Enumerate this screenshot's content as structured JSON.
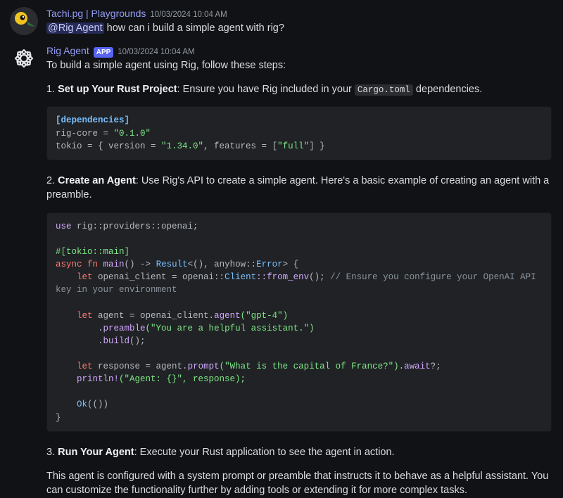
{
  "messages": [
    {
      "author": "Tachi.pg | Playgrounds",
      "timestamp": "10/03/2024 10:04 AM",
      "mention": "@Rig Agent",
      "text_after_mention": " how can i build a simple agent with rig?"
    },
    {
      "author": "Rig Agent",
      "badge": "APP",
      "timestamp": "10/03/2024 10:04 AM",
      "intro": "To build a simple agent using Rig, follow these steps:",
      "step1_num": "1. ",
      "step1_title": "Set up Your Rust Project",
      "step1_rest_a": ": Ensure you have Rig included in your ",
      "step1_code": "Cargo.toml",
      "step1_rest_b": " dependencies.",
      "code1": {
        "l1_section": "[dependencies]",
        "l2_key": "rig-core = ",
        "l2_val": "\"0.1.0\"",
        "l3_a": "tokio = { version = ",
        "l3_v1": "\"1.34.0\"",
        "l3_b": ", features = [",
        "l3_v2": "\"full\"",
        "l3_c": "] }"
      },
      "step2_num": "2. ",
      "step2_title": "Create an Agent",
      "step2_rest": ": Use Rig's API to create a simple agent. Here's a basic example of creating an agent with a preamble.",
      "code2": {
        "use": "use",
        "use_path": " rig::providers::openai;",
        "attr": "#[tokio::main]",
        "async": "async",
        "fn": " fn ",
        "main": "main",
        "sig_a": "() -> ",
        "Result": "Result",
        "sig_b": "<(), anyhow::",
        "Error": "Error",
        "sig_c": "> {",
        "let1": "    let",
        "client_decl": " openai_client = openai::",
        "Client": "Client",
        "from_env": "::from_env",
        "after_from_env": "(); ",
        "comment": "// Ensure you configure your OpenAI API key in your environment",
        "let2": "    let",
        "agent_decl_a": " agent = openai_client.",
        "agent_fn": "agent",
        "agent_arg": "(\"gpt-4\")",
        "preamble_indent": "        .",
        "preamble_fn": "preamble",
        "preamble_arg": "(\"You are a helpful assistant.\")",
        "build_indent": "        .",
        "build_fn": "build",
        "build_end": "();",
        "let3": "    let",
        "response_a": " response = agent.",
        "prompt_fn": "prompt",
        "prompt_arg": "(\"What is the capital of France?\")",
        "dot_await": ".await",
        "qend": "?;",
        "println": "    println!",
        "println_arg": "(\"Agent: {}\", response);",
        "ok": "    Ok",
        "ok_end": "(())",
        "brace": "}"
      },
      "step3_num": "3. ",
      "step3_title": "Run Your Agent",
      "step3_rest": ": Execute your Rust application to see the agent in action.",
      "outro": "This agent is configured with a system prompt or preamble that instructs it to behave as a helpful assistant. You can customize the functionality further by adding tools or extending it for more complex tasks."
    }
  ]
}
